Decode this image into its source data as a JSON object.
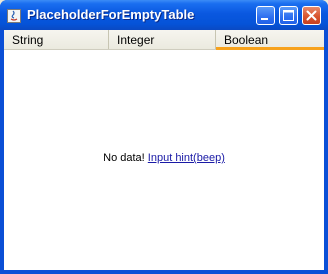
{
  "window": {
    "title": "PlaceholderForEmptyTable",
    "icon": "java-app-icon",
    "controls": {
      "minimize": "minimize-icon",
      "maximize": "maximize-icon",
      "close": "close-icon"
    }
  },
  "table": {
    "columns": [
      "String",
      "Integer",
      "Boolean"
    ],
    "active_column_accent": "#f7a21c"
  },
  "empty_state": {
    "message": "No data!",
    "link_label": "Input hint(beep)"
  },
  "colors": {
    "titlebar": "#0553d8",
    "close_button": "#d8552f",
    "link": "#1a1aa6"
  }
}
